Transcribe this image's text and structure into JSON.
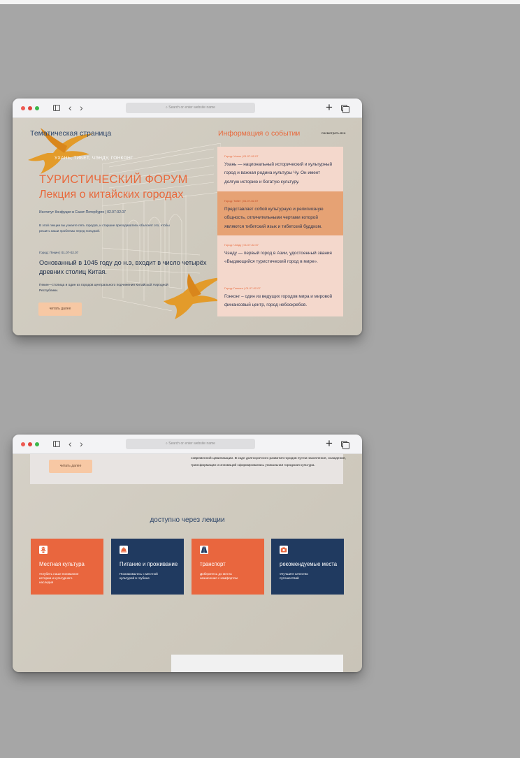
{
  "browser": {
    "url_placeholder": "Search or enter website name",
    "back_glyph": "‹",
    "forward_glyph": "›",
    "new_tab_glyph": "+"
  },
  "window1": {
    "page_title": "Тематическая страница",
    "cities": "УХАНЬ, ТИБЕТ, ЧЭНДУ, ГОНКОНГ",
    "forum_title": "ТУРИСТИЧЕСКИЙ ФОРУМ",
    "lecture_title": "Лекция о китайских городах",
    "institute": "Институт Конфуция в Санкт-Петербурге | 02.07-02.07",
    "intro": "В этой лекции вы узнаете пять городов, и старшие преподаватели объяснят это, чтобы решить ваши проблемы перед поездкой.",
    "meta_small": "Город: Пекин | 01.07-02.07",
    "main_claim": "Основанный в 1045 году до н.э, входит в число четырёх древних столиц Китая.",
    "claim_sub": "Пекин—столица и один из городов центрального подчинения Китайской Народной Республики.",
    "read_more": "читать далее",
    "event_section_title": "Информация о событии",
    "view_all": "посмотреть все",
    "events": [
      {
        "meta": "Город: Ухань | 01.07-02.07",
        "desc": "Ухань — национальный исторический и культурный город и важная родина культуры Чу. Он имеет долгую историю и богатую культуру."
      },
      {
        "meta": "Город: Тибет | 01.07-02.07",
        "desc": "Представляет собой культурную и религиозную общность, отличительными чертами которой являются тибетский язык и тибетский буддизм."
      },
      {
        "meta": "Город: Чэнду | 01.07-02.07",
        "desc": "Чэнду — первый город в Азии, удостоенный звания «Выдающийся туристический город в мире»."
      },
      {
        "meta": "Город: Гонконг | 01.07-02.07",
        "desc": "Гонконг – один из ведущих городов мира и мировой финансовый центр, город небоскребов."
      }
    ]
  },
  "window2": {
    "read_more": "читать далее",
    "history_text": "современной цивилизации. В ходе долгосрочного развития городов путем накопления, осаждения, трансформации и инноваций сформировалась уникальная городская культура.",
    "lectures_heading": "доступно через лекции",
    "cards": [
      {
        "icon": "pagoda-icon",
        "title": "Местная культура",
        "desc": "Углубить наше понимание истории и культурного наследия"
      },
      {
        "icon": "cloche-icon",
        "title": "Питание и проживание",
        "desc": "Познакомьтесь с местной культурой в глубине"
      },
      {
        "icon": "road-icon",
        "title": "транспорт",
        "desc": "Доберитесь до места назначения с комфортом"
      },
      {
        "icon": "camera-icon",
        "title": "рекомендуемые места",
        "desc": "Улучшите качество путешествий"
      }
    ]
  },
  "colors": {
    "accent_orange": "#e8693c",
    "navy": "#203a60",
    "peach": "#f4d8cc",
    "button_peach": "#f7c8a4"
  }
}
